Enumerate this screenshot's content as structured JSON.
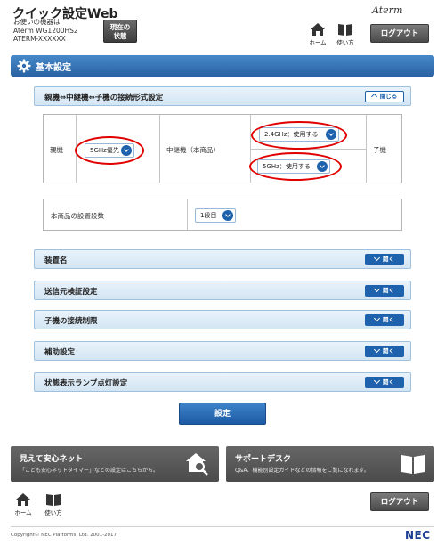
{
  "header": {
    "app_title": "クイック設定Web",
    "device_caption": "お使いの機器は",
    "device_model": "Aterm WG1200HS2",
    "device_serial": "ATERM-XXXXXX",
    "status_button_line1": "現在の",
    "status_button_line2": "状態",
    "brand": "Aterm",
    "home_label": "ホーム",
    "help_label": "使い方",
    "logout_label": "ログアウト"
  },
  "page": {
    "title": "基本設定",
    "title_icon": "gear-icon"
  },
  "connection_section": {
    "title": "親機⇔中継機⇔子機の接続形式設定",
    "toggle_label": "閉じる",
    "parent_label": "親機",
    "parent_select": "5GHz優先",
    "repeater_label": "中継機（本商品）",
    "repeater_select_upper": "2.4GHz：使用する",
    "repeater_select_lower": "5GHz：使用する",
    "child_label": "子機",
    "highlight_color": "#e00000"
  },
  "install_stage": {
    "label": "本商品の設置段数",
    "select_value": "1段目"
  },
  "sections": [
    {
      "title": "装置名",
      "toggle_label": "開く"
    },
    {
      "title": "送信元検証設定",
      "toggle_label": "開く"
    },
    {
      "title": "子機の接続制限",
      "toggle_label": "開く"
    },
    {
      "title": "補助設定",
      "toggle_label": "開く"
    },
    {
      "title": "状態表示ランプ点灯設定",
      "toggle_label": "開く"
    }
  ],
  "submit_label": "設定",
  "banners": [
    {
      "title": "見えて安心ネット",
      "subtitle": "「こども安心ネットタイマー」などの設定はこちらから。",
      "icon": "home-search-icon"
    },
    {
      "title": "サポートデスク",
      "subtitle": "Q&A、機能別設定ガイドなどの情報をご覧になれます。",
      "icon": "book-icon"
    }
  ],
  "footer": {
    "home_label": "ホーム",
    "help_label": "使い方",
    "logout_label": "ログアウト",
    "copyright": "Copyright© NEC Platforms, Ltd. 2001-2017",
    "logo": "NEC"
  },
  "colors": {
    "accent_blue": "#1e62ad",
    "title_bar": "#2a62a3",
    "highlight": "#e00000"
  }
}
